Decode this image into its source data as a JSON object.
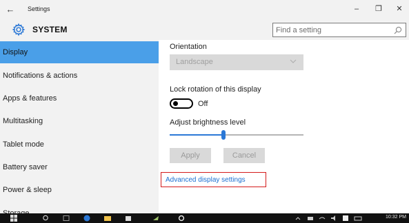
{
  "window": {
    "title": "Settings",
    "back_glyph": "←",
    "minimize_glyph": "–",
    "restore_glyph": "❐",
    "close_glyph": "✕"
  },
  "header": {
    "section_title": "SYSTEM",
    "search_placeholder": "Find a setting",
    "icon": "gear-icon"
  },
  "sidebar": {
    "items": [
      {
        "label": "Display",
        "active": true
      },
      {
        "label": "Notifications & actions",
        "active": false
      },
      {
        "label": "Apps & features",
        "active": false
      },
      {
        "label": "Multitasking",
        "active": false
      },
      {
        "label": "Tablet mode",
        "active": false
      },
      {
        "label": "Battery saver",
        "active": false
      },
      {
        "label": "Power & sleep",
        "active": false
      },
      {
        "label": "Storage",
        "active": false
      }
    ]
  },
  "main": {
    "orientation_label": "Orientation",
    "orientation_value": "Landscape",
    "lock_rotation_label": "Lock rotation of this display",
    "lock_rotation_state": "Off",
    "brightness_label": "Adjust brightness level",
    "brightness_level": 0.4,
    "apply_label": "Apply",
    "cancel_label": "Cancel",
    "advanced_link": "Advanced display settings"
  },
  "taskbar": {
    "time": "10:32 PM"
  },
  "colors": {
    "accent": "#4a9fe8",
    "slider": "#2b78d6",
    "link": "#1a6fd1",
    "highlight_box": "#d41a1a"
  }
}
